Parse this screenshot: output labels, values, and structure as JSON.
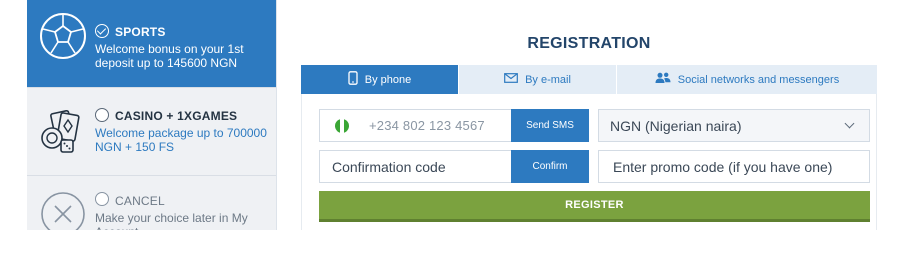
{
  "bonuses": {
    "sports": {
      "title": "SPORTS",
      "description": "Welcome bonus on your 1st deposit up to 145600 NGN",
      "icon": "soccer-ball-icon",
      "selected": true
    },
    "casino": {
      "title": "CASINO + 1XGAMES",
      "description": "Welcome package up to 700000 NGN + 150 FS",
      "icon": "casino-cards-chips-icon",
      "selected": false
    },
    "cancel": {
      "title": "CANCEL",
      "description": "Make your choice later in My Account",
      "icon": "close-circle-icon",
      "selected": false
    }
  },
  "registration": {
    "title": "REGISTRATION",
    "tabs": [
      {
        "label": "By phone",
        "icon": "phone-icon",
        "active": true
      },
      {
        "label": "By e-mail",
        "icon": "envelope-icon",
        "active": false
      },
      {
        "label": "Social networks and messengers",
        "icon": "users-icon",
        "active": false
      }
    ],
    "phone_placeholder": "+234 802 123 4567",
    "send_sms_label": "Send SMS",
    "currency_value": "NGN (Nigerian naira)",
    "confirmation_placeholder": "Confirmation code",
    "confirm_label": "Confirm",
    "promo_placeholder": "Enter promo code (if you have one)",
    "register_label": "REGISTER"
  },
  "colors": {
    "primary_blue": "#2d7ac0",
    "register_green": "#7ba23f",
    "title_navy": "#23456a",
    "nigeria_green": "#3aa635"
  }
}
